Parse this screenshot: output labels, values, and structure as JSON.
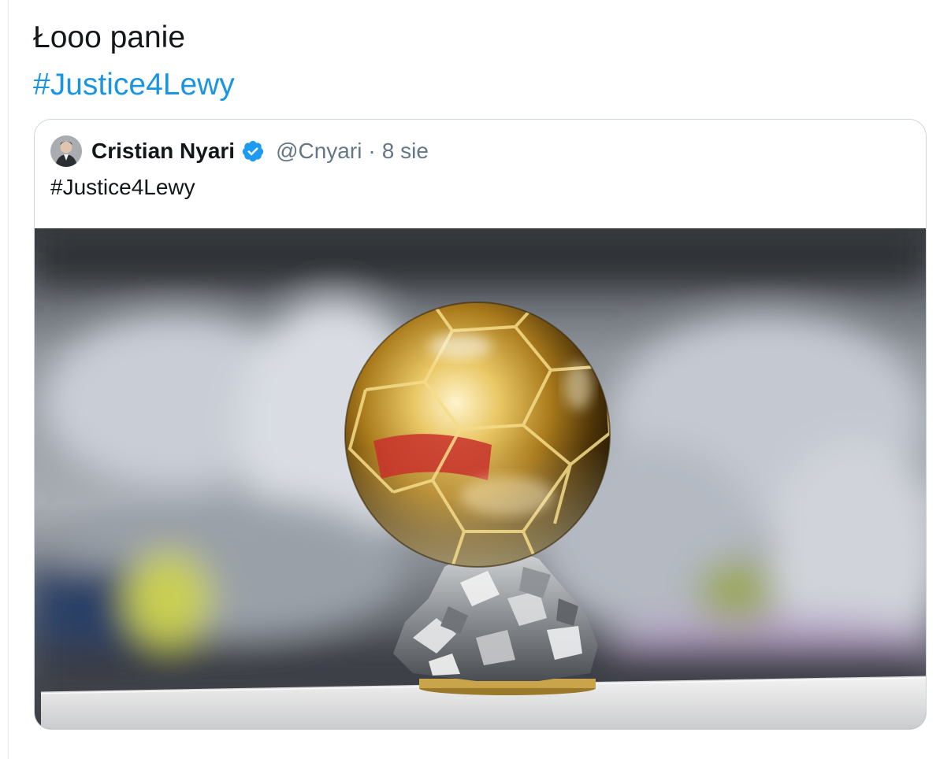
{
  "tweet": {
    "text_line1": "Łooo panie",
    "hashtag": "#Justice4Lewy"
  },
  "quoted_tweet": {
    "author_name": "Cristian Nyari",
    "verified": true,
    "handle": "@Cnyari",
    "separator": "·",
    "date": "8 sie",
    "text": "#Justice4Lewy",
    "media_alt": "golden-ball-trophy-photo"
  },
  "colors": {
    "hashtag_blue": "#1b95e0",
    "verified_blue": "#1d9bf0",
    "text_primary": "#14171a",
    "text_secondary": "#657786",
    "card_border": "#ccd6dd"
  },
  "icons": {
    "verified": "verified-badge-icon",
    "avatar": "avatar"
  }
}
